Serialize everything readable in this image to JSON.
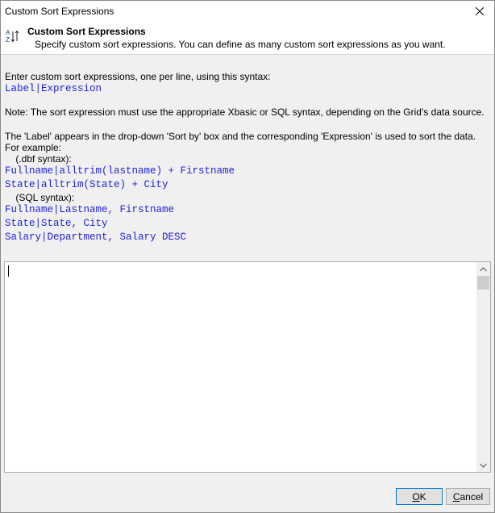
{
  "window": {
    "title": "Custom Sort Expressions"
  },
  "header": {
    "title": "Custom Sort Expressions",
    "subtitle": "Specify custom sort expressions. You can define as many custom sort expressions as you want."
  },
  "body": {
    "intro": "Enter custom sort expressions, one per line, using this syntax:",
    "syntax": "Label|Expression",
    "note": "Note: The sort expression must use the appropriate Xbasic or SQL syntax, depending on the Grid's data source.",
    "explain": "The 'Label' appears in the drop-down 'Sort by' box and the corresponding 'Expression' is used to sort the data.",
    "for_example": "For example:",
    "dbf_heading": "    (.dbf syntax):",
    "dbf_examples": [
      "Fullname|alltrim(lastname) + Firstname",
      "State|alltrim(State) + City"
    ],
    "sql_heading": "    (SQL syntax):",
    "sql_examples": [
      "Fullname|Lastname, Firstname",
      "State|State, City",
      "Salary|Department, Salary DESC"
    ]
  },
  "editor": {
    "value": ""
  },
  "buttons": {
    "ok_label_underlined": "O",
    "ok_label_rest": "K",
    "cancel_label_underlined": "C",
    "cancel_label_rest": "ancel"
  },
  "colors": {
    "code": "#1f1fdc",
    "ok_border": "#0078d7"
  },
  "icons": {
    "header": "sort-az-icon",
    "close": "close-icon",
    "scroll_up": "chevron-up-icon",
    "scroll_down": "chevron-down-icon"
  }
}
